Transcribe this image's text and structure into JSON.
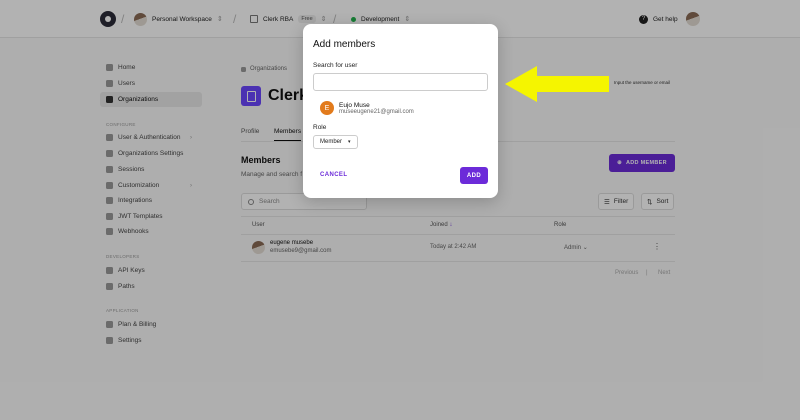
{
  "topbar": {
    "workspace": "Personal Workspace",
    "app": "Clerk RBA",
    "plan": "Free",
    "environment": "Development",
    "help": "Get help"
  },
  "sidebar": {
    "items_top": [
      {
        "label": "Home",
        "icon": "home-icon"
      },
      {
        "label": "Users",
        "icon": "users-icon"
      },
      {
        "label": "Organizations",
        "icon": "organizations-icon",
        "active": true
      }
    ],
    "section_configure": "CONFIGURE",
    "items_configure": [
      {
        "label": "User & Authentication",
        "icon": "lock-icon",
        "expandable": true
      },
      {
        "label": "Organizations Settings",
        "icon": "building-icon"
      },
      {
        "label": "Sessions",
        "icon": "session-icon"
      },
      {
        "label": "Customization",
        "icon": "brush-icon",
        "expandable": true
      },
      {
        "label": "Integrations",
        "icon": "plug-icon"
      },
      {
        "label": "JWT Templates",
        "icon": "jwt-icon"
      },
      {
        "label": "Webhooks",
        "icon": "webhook-icon"
      }
    ],
    "section_developers": "DEVELOPERS",
    "items_developers": [
      {
        "label": "API Keys",
        "icon": "key-icon"
      },
      {
        "label": "Paths",
        "icon": "paths-icon"
      }
    ],
    "section_application": "APPLICATION",
    "items_application": [
      {
        "label": "Plan & Billing",
        "icon": "billing-icon"
      },
      {
        "label": "Settings",
        "icon": "gear-icon"
      }
    ]
  },
  "main": {
    "breadcrumb": "Organizations",
    "title": "Clerk",
    "tabs": [
      "Profile",
      "Members"
    ],
    "section_title": "Members",
    "section_sub": "Manage and search f",
    "add_member": "ADD MEMBER",
    "search_placeholder": "Search",
    "filter": "Filter",
    "sort": "Sort",
    "columns": [
      "User",
      "Joined",
      "Role"
    ],
    "rows": [
      {
        "name": "eugene musebe",
        "email": "emusebe9@gmail.com",
        "joined": "Today at 2:42 AM",
        "role": "Admin"
      }
    ],
    "previous": "Previous",
    "next": "Next"
  },
  "modal": {
    "title": "Add members",
    "search_label": "Search for user",
    "search_value": "",
    "user_initial": "E",
    "user_name": "Eujo Muse",
    "user_email": "museeugene21@gmail.com",
    "role_label": "Role",
    "role_value": "Member",
    "cancel": "CANCEL",
    "add": "ADD"
  },
  "annotation": {
    "note": "Input the username or email",
    "arrow_color": "#f5f500"
  },
  "colors": {
    "accent": "#6c2bd9",
    "org_badge": "#6c47ff",
    "avatar_orange": "#e27b1c",
    "env_dot": "#22b24c"
  }
}
